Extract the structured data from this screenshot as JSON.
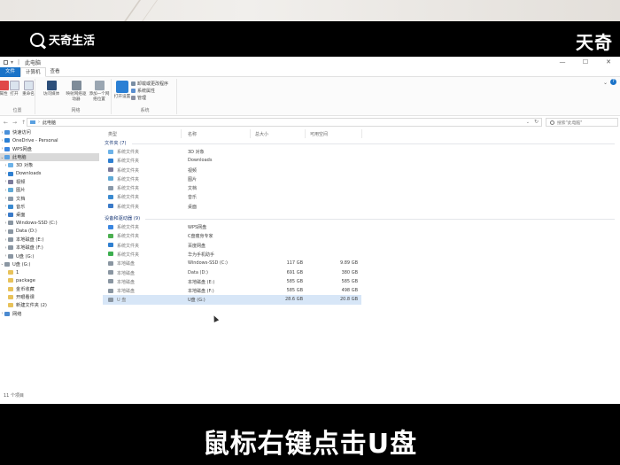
{
  "watermark": {
    "logo_text": "天奇生活",
    "corner_text": "天奇"
  },
  "subtitle": "鼠标右键点击U盘",
  "window": {
    "title": "此电脑",
    "controls": [
      "—",
      "☐",
      "✕"
    ],
    "tabs": [
      {
        "label": "文件",
        "state": "file"
      },
      {
        "label": "计算机",
        "state": "active"
      },
      {
        "label": "查看",
        "state": ""
      }
    ],
    "ribbon": {
      "location_group": {
        "name": "位置",
        "buttons": [
          "属性",
          "打开",
          "重命名"
        ]
      },
      "network_group": {
        "name": "网络",
        "buttons": [
          "访问媒体",
          "映射网络驱动器",
          "添加一个网络位置"
        ]
      },
      "system_group": {
        "name": "系统",
        "open_settings": "打开设置",
        "links": [
          "卸载或更改程序",
          "系统属性",
          "管理"
        ]
      }
    },
    "address": {
      "path": "此电脑",
      "search_placeholder": "搜索\"此电脑\""
    }
  },
  "nav_items": [
    {
      "label": "快速访问",
      "expand": "›",
      "indent": 0,
      "color": "#4a90d9",
      "selected": false
    },
    {
      "label": "OneDrive - Personal",
      "expand": "›",
      "indent": 0,
      "color": "#2a7fd4",
      "selected": false
    },
    {
      "label": "WPS网盘",
      "expand": "›",
      "indent": 0,
      "color": "#3a86e0",
      "selected": false
    },
    {
      "label": "此电脑",
      "expand": "⌄",
      "indent": 0,
      "color": "#5aa0e0",
      "selected": true
    },
    {
      "label": "3D 对象",
      "expand": "›",
      "indent": 1,
      "color": "#6cb2e8",
      "selected": false
    },
    {
      "label": "Downloads",
      "expand": "›",
      "indent": 1,
      "color": "#2f7fd0",
      "selected": false
    },
    {
      "label": "视频",
      "expand": "›",
      "indent": 1,
      "color": "#7a7a9a",
      "selected": false
    },
    {
      "label": "图片",
      "expand": "›",
      "indent": 1,
      "color": "#5fa9d6",
      "selected": false
    },
    {
      "label": "文档",
      "expand": "›",
      "indent": 1,
      "color": "#8a9aaa",
      "selected": false
    },
    {
      "label": "音乐",
      "expand": "›",
      "indent": 1,
      "color": "#3a8ad0",
      "selected": false
    },
    {
      "label": "桌面",
      "expand": "›",
      "indent": 1,
      "color": "#3a7ac8",
      "selected": false
    },
    {
      "label": "Windows-SSD (C:)",
      "expand": "›",
      "indent": 1,
      "color": "#8a96a2",
      "selected": false
    },
    {
      "label": "Data (D:)",
      "expand": "›",
      "indent": 1,
      "color": "#8a96a2",
      "selected": false
    },
    {
      "label": "本地磁盘 (E:)",
      "expand": "›",
      "indent": 1,
      "color": "#8a96a2",
      "selected": false
    },
    {
      "label": "本地磁盘 (F:)",
      "expand": "›",
      "indent": 1,
      "color": "#8a96a2",
      "selected": false
    },
    {
      "label": "U盘 (G:)",
      "expand": "›",
      "indent": 1,
      "color": "#8a96a2",
      "selected": false
    },
    {
      "label": "U盘 (G:)",
      "expand": "⌄",
      "indent": 0,
      "color": "#8a96a2",
      "selected": false
    },
    {
      "label": "1",
      "expand": "",
      "indent": 1,
      "color": "#e8c25a",
      "selected": false
    },
    {
      "label": "package",
      "expand": "",
      "indent": 1,
      "color": "#e8c25a",
      "selected": false
    },
    {
      "label": "金币收藏",
      "expand": "",
      "indent": 1,
      "color": "#e8c25a",
      "selected": false
    },
    {
      "label": "开眼看课",
      "expand": "",
      "indent": 1,
      "color": "#e8c25a",
      "selected": false
    },
    {
      "label": "新建文件夹 (2)",
      "expand": "",
      "indent": 1,
      "color": "#e8c25a",
      "selected": false
    },
    {
      "label": "网络",
      "expand": "›",
      "indent": 0,
      "color": "#4a8ad0",
      "selected": false
    }
  ],
  "status_text": "11 个项目",
  "columns": [
    "类型",
    "名称",
    "总大小",
    "可用空间"
  ],
  "groups": [
    {
      "title": "文件夹 (7)",
      "rows": [
        {
          "type": "系统文件夹",
          "name": "3D 对象",
          "total": "",
          "free": "",
          "color": "#6cb2e8",
          "selected": false
        },
        {
          "type": "系统文件夹",
          "name": "Downloads",
          "total": "",
          "free": "",
          "color": "#2f7fd0",
          "selected": false
        },
        {
          "type": "系统文件夹",
          "name": "视频",
          "total": "",
          "free": "",
          "color": "#7a7a9a",
          "selected": false
        },
        {
          "type": "系统文件夹",
          "name": "图片",
          "total": "",
          "free": "",
          "color": "#5fa9d6",
          "selected": false
        },
        {
          "type": "系统文件夹",
          "name": "文档",
          "total": "",
          "free": "",
          "color": "#8a9aaa",
          "selected": false
        },
        {
          "type": "系统文件夹",
          "name": "音乐",
          "total": "",
          "free": "",
          "color": "#3a8ad0",
          "selected": false
        },
        {
          "type": "系统文件夹",
          "name": "桌面",
          "total": "",
          "free": "",
          "color": "#3a7ac8",
          "selected": false
        }
      ]
    },
    {
      "title": "设备和驱动器 (9)",
      "rows": [
        {
          "type": "系统文件夹",
          "name": "WPS网盘",
          "total": "",
          "free": "",
          "color": "#3a86e0",
          "selected": false
        },
        {
          "type": "系统文件夹",
          "name": "C盘瘦身专家",
          "total": "",
          "free": "",
          "color": "#4caf50",
          "selected": false
        },
        {
          "type": "系统文件夹",
          "name": "百度网盘",
          "total": "",
          "free": "",
          "color": "#2f7fd0",
          "selected": false
        },
        {
          "type": "系统文件夹",
          "name": "华为手机助手",
          "total": "",
          "free": "",
          "color": "#3cae4f",
          "selected": false
        },
        {
          "type": "本地磁盘",
          "name": "Windows-SSD (C:)",
          "total": "117 GB",
          "free": "9.89 GB",
          "color": "#8a96a2",
          "selected": false
        },
        {
          "type": "本地磁盘",
          "name": "Data (D:)",
          "total": "691 GB",
          "free": "380 GB",
          "color": "#8a96a2",
          "selected": false
        },
        {
          "type": "本地磁盘",
          "name": "本地磁盘 (E:)",
          "total": "585 GB",
          "free": "585 GB",
          "color": "#8a96a2",
          "selected": false
        },
        {
          "type": "本地磁盘",
          "name": "本地磁盘 (F:)",
          "total": "585 GB",
          "free": "498 GB",
          "color": "#8a96a2",
          "selected": false
        },
        {
          "type": "U 盘",
          "name": "U盘 (G:)",
          "total": "28.6 GB",
          "free": "20.8 GB",
          "color": "#8a96a2",
          "selected": true
        }
      ]
    }
  ]
}
